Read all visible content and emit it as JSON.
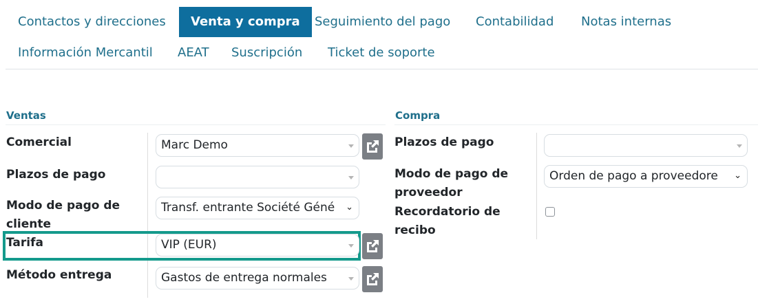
{
  "tabs": {
    "t1": "Contactos y direcciones",
    "t2": "Venta y compra",
    "t3": "Seguimiento del pago",
    "t4": "Contabilidad",
    "t5": "Notas internas",
    "t6": "Información Mercantil",
    "t7": "AEAT",
    "t8": "Suscripción",
    "t9": "Ticket de soporte",
    "active": "Venta y compra"
  },
  "ventas": {
    "title": "Ventas",
    "comercial_label": "Comercial",
    "comercial_value": "Marc Demo",
    "plazos_label": "Plazos de pago",
    "plazos_value": "",
    "modo_label_1": "Modo de pago de",
    "modo_label_2": "cliente",
    "modo_value": "Transf. entrante Société Géné",
    "tarifa_label": "Tarifa",
    "tarifa_value": "VIP (EUR)",
    "metodo_label": "Método entrega",
    "metodo_value": "Gastos de entrega normales"
  },
  "compra": {
    "title": "Compra",
    "plazos_label": "Plazos de pago",
    "plazos_value": "",
    "modo_label_1": "Modo de pago de",
    "modo_label_2": "proveedor",
    "modo_value": "Orden de pago a proveedore",
    "recordatorio_label_1": "Recordatorio de",
    "recordatorio_label_2": "recibo",
    "recordatorio_checked": false
  },
  "colors": {
    "accent": "#0e6e9e",
    "link": "#1f6f8b",
    "highlight": "#149a8c"
  },
  "icons": {
    "external": "external-link-icon",
    "caret": "caret-down-icon",
    "chevron": "chevron-down-icon"
  }
}
